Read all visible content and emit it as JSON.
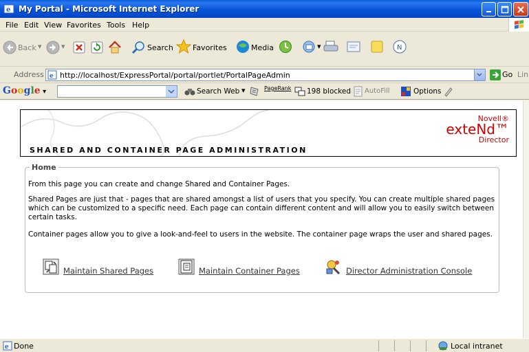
{
  "window": {
    "title": "My Portal - Microsoft Internet Explorer"
  },
  "menu": [
    "File",
    "Edit",
    "View",
    "Favorites",
    "Tools",
    "Help"
  ],
  "toolbar": {
    "back_label": "Back",
    "search_label": "Search",
    "favorites_label": "Favorites",
    "media_label": "Media"
  },
  "address": {
    "label": "Address",
    "url": "http://localhost/ExpressPortal/portal/portlet/PortalPageAdmin",
    "go_label": "Go",
    "links_label": "Links"
  },
  "google_bar": {
    "logo": "Google",
    "search_web": "Search Web",
    "pagerank": "PageRank",
    "blocked": "198 blocked",
    "autofill": "AutoFill",
    "options": "Options"
  },
  "page": {
    "banner_title": "SHARED AND CONTAINER PAGE ADMINISTRATION",
    "brand_line1": "Novell®",
    "brand_line2": "exteNd™",
    "brand_line3": "Director",
    "section_legend": "Home",
    "para1": "From this page you can create and change Shared and Container Pages.",
    "para2": "Shared Pages are just that - pages that are shared amongst a list of users that you specify. You can create multiple shared pages which can be customized to a specific need. Each page can contain different content and will allow you to easily switch between certain tasks.",
    "para3": "Container pages allow you to give a look-and-feel to users in the website. The container page wraps the user and shared pages.",
    "links": [
      {
        "label": "Maintain Shared Pages"
      },
      {
        "label": "Maintain Container Pages"
      },
      {
        "label": "Director Administration Console"
      }
    ]
  },
  "status": {
    "text": "Done",
    "zone": "Local intranet"
  }
}
